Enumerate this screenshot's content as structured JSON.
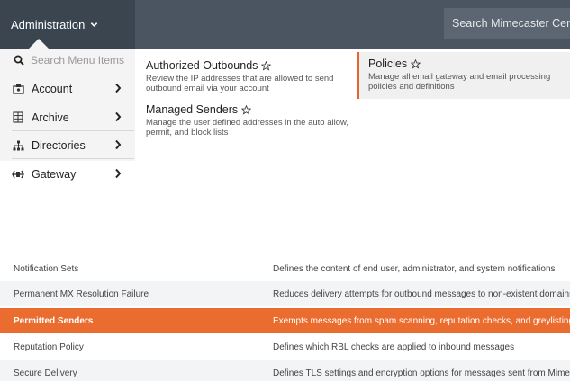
{
  "topbar": {
    "admin_label": "Administration",
    "search_placeholder": "Search Mimecaster Central"
  },
  "sidebar": {
    "search_placeholder": "Search Menu Items",
    "items": [
      {
        "label": "Account",
        "icon": "account-icon"
      },
      {
        "label": "Archive",
        "icon": "archive-icon"
      },
      {
        "label": "Directories",
        "icon": "directories-icon"
      },
      {
        "label": "Gateway",
        "icon": "gateway-icon"
      }
    ]
  },
  "menu": {
    "authorized_outbounds": {
      "title": "Authorized Outbounds",
      "desc": "Review the IP addresses that are allowed to send outbound email via your account"
    },
    "managed_senders": {
      "title": "Managed Senders",
      "desc": "Manage the user defined addresses in the auto allow, permit, and block lists"
    },
    "policies": {
      "title": "Policies",
      "desc": "Manage all email gateway and email processing policies and definitions"
    }
  },
  "table": {
    "rows": [
      {
        "name": "Notification Sets",
        "desc": "Defines the content of end user, administrator, and system notifications"
      },
      {
        "name": "Permanent MX Resolution Failure",
        "desc": "Reduces delivery attempts for outbound messages to non-existent domains"
      },
      {
        "name": "Permitted Senders",
        "desc": "Exempts messages from spam scanning, reputation checks, and greylisting"
      },
      {
        "name": "Reputation Policy",
        "desc": "Defines which RBL checks are applied to inbound messages"
      },
      {
        "name": "Secure Delivery",
        "desc": "Defines TLS settings and encryption options for messages sent from Mimecast"
      }
    ]
  },
  "colors": {
    "topbar": "#4a5561",
    "accent": "#ea6c2f"
  }
}
